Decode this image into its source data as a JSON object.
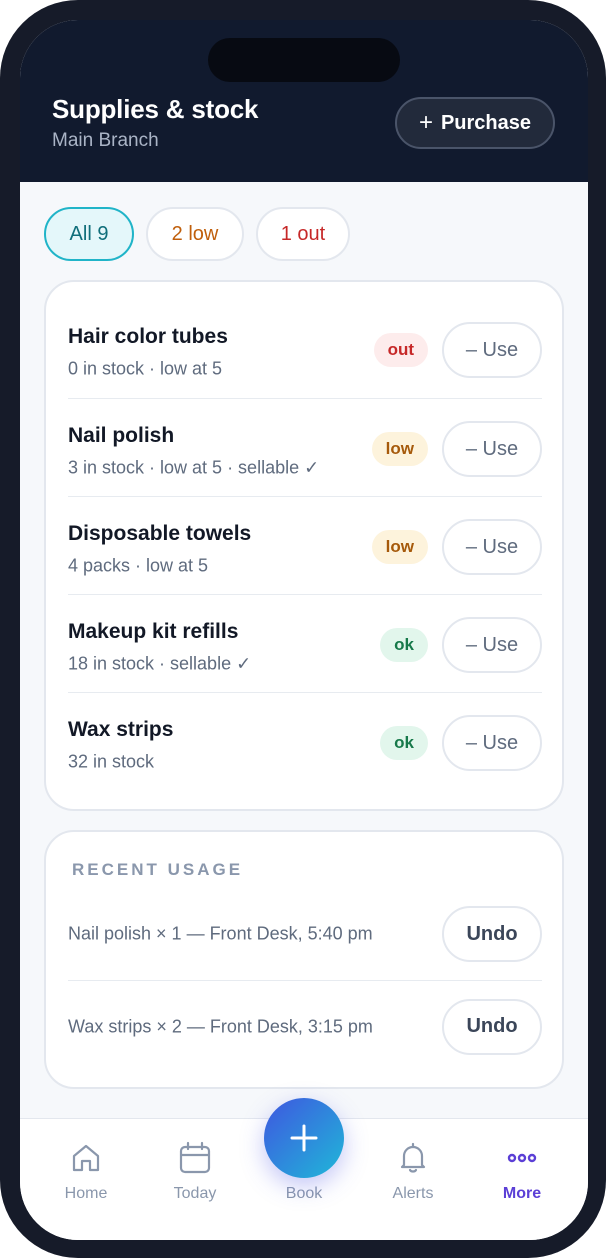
{
  "header": {
    "title": "Supplies & stock",
    "subtitle": "Main Branch",
    "purchase_icon": "+",
    "purchase_label": "Purchase"
  },
  "filters": [
    {
      "label": "All 9",
      "active": true
    },
    {
      "label": "2 low",
      "active": false
    },
    {
      "label": "1 out",
      "active": false
    }
  ],
  "items": [
    {
      "name": "Hair color tubes",
      "meta": "0 in stock · low at 5",
      "status": "out",
      "action": "– Use"
    },
    {
      "name": "Nail polish",
      "meta": "3 in stock · low at 5 · sellable ✓",
      "status": "low",
      "action": "– Use"
    },
    {
      "name": "Disposable towels",
      "meta": "4 packs · low at 5",
      "status": "low",
      "action": "– Use"
    },
    {
      "name": "Makeup kit refills",
      "meta": "18 in stock · sellable ✓",
      "status": "ok",
      "action": "– Use"
    },
    {
      "name": "Wax strips",
      "meta": "32 in stock",
      "status": "ok",
      "action": "– Use"
    }
  ],
  "recent_usage": {
    "heading": "RECENT USAGE",
    "entries": [
      {
        "text": "Nail polish × 1 — Front Desk, 5:40 pm",
        "action": "Undo"
      },
      {
        "text": "Wax strips × 2 — Front Desk, 3:15 pm",
        "action": "Undo"
      }
    ]
  },
  "nav": {
    "items": [
      {
        "label": "Home",
        "icon": "home-icon",
        "active": false
      },
      {
        "label": "Today",
        "icon": "calendar-icon",
        "active": false
      },
      {
        "label": "Book",
        "icon": "plus-icon",
        "active": false
      },
      {
        "label": "Alerts",
        "icon": "bell-icon",
        "active": false
      },
      {
        "label": "More",
        "icon": "more-dots-icon",
        "active": true
      }
    ]
  },
  "colors": {
    "header_bg": "#111a2e",
    "accent_teal": "#20b4c8",
    "low": "#c05f0c",
    "out": "#c62828",
    "ok": "#17794a",
    "active_nav": "#5b3fd6"
  }
}
